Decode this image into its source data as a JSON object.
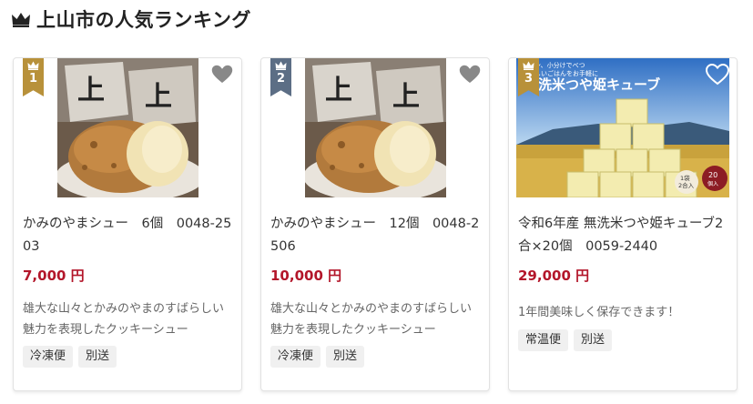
{
  "section": {
    "title": "上山市の人気ランキング",
    "icon": "crown-icon"
  },
  "products": [
    {
      "rank": "1",
      "rank_color": "#b8913a",
      "name": "かみのやまシュー　6個　0048-2503",
      "price": "7,000 円",
      "description": "雄大な山々とかみのやまのすばらしい魅力を表現したクッキーシュー",
      "tags": [
        "冷凍便",
        "別送"
      ]
    },
    {
      "rank": "2",
      "rank_color": "#5c6e85",
      "name": "かみのやまシュー　12個　0048-2506",
      "price": "10,000 円",
      "description": "雄大な山々とかみのやまのすばらしい魅力を表現したクッキーシュー",
      "tags": [
        "冷凍便",
        "別送"
      ]
    },
    {
      "rank": "3",
      "rank_color": "#b8913a",
      "name": "令和6年産 無洗米つや姫キューブ2合×20個　0059-2440",
      "price": "29,000 円",
      "description": "1年間美味しく保存できます！",
      "tags": [
        "常温便",
        "別送"
      ],
      "image_text": {
        "headline": "洗米つや姫キューブ",
        "small": "コクン、小分けでべつ\nおいしいごはんをお手軽に",
        "badge_left": "1袋\n2合入",
        "badge_right": "20\n個入"
      }
    }
  ],
  "colors": {
    "price": "#b3162a",
    "gold": "#b8913a",
    "silver": "#5c6e85"
  }
}
